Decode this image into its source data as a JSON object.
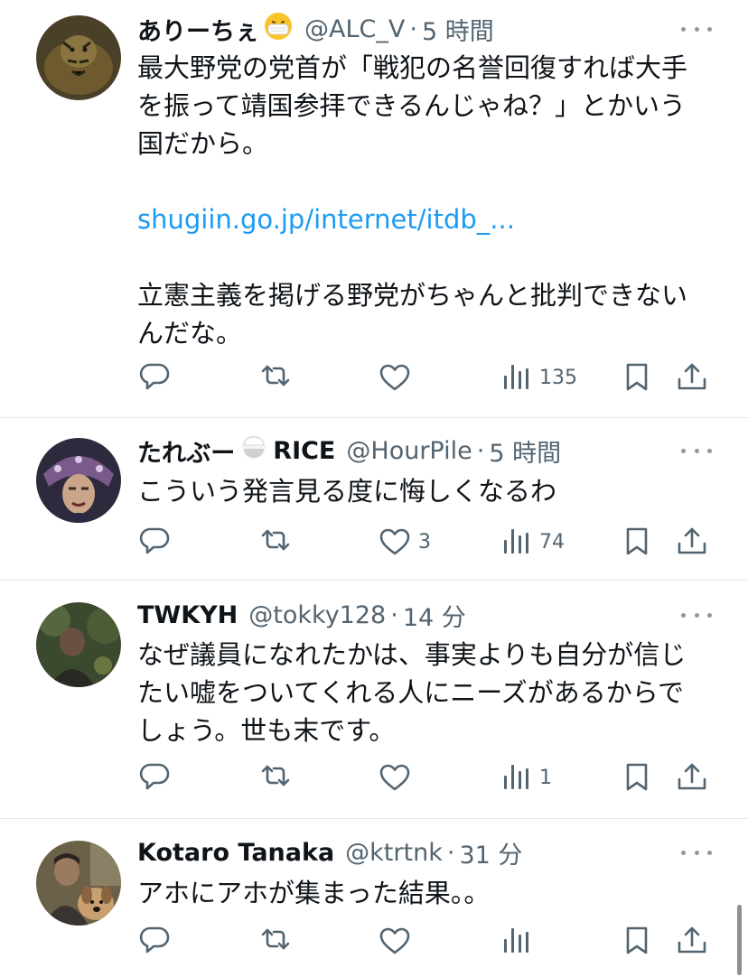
{
  "tweets": [
    {
      "name": "ありーちぇ",
      "emoji": "mask-face",
      "handle": "@ALC_V",
      "separator": "·",
      "time": "5 時間",
      "lines": [
        "最大野党の党首が「戦犯の名誉回復すれば大手",
        "を振って靖国参拝できるんじゃね？」とかいう",
        "国だから。"
      ],
      "link": "shugiin.go.jp/internet/itdb_...",
      "lines2": [
        "立憲主義を掲げる野党がちゃんと批判できない",
        "んだな。"
      ],
      "replies": "",
      "retweets": "",
      "likes": "",
      "views": "135"
    },
    {
      "name": "たれぶー",
      "emoji": "rice-bowl",
      "name_suffix": "RICE",
      "handle": "@HourPile",
      "separator": "·",
      "time": "5 時間",
      "lines": [
        "こういう発言見る度に悔しくなるわ"
      ],
      "replies": "",
      "retweets": "",
      "likes": "3",
      "views": "74"
    },
    {
      "name": "TWKYH",
      "handle": "@tokky128",
      "separator": "·",
      "time": "14 分",
      "lines": [
        "なぜ議員になれたかは、事実よりも自分が信じ",
        "たい嘘をついてくれる人にニーズがあるからで",
        "しょう。世も末です。"
      ],
      "replies": "",
      "retweets": "",
      "likes": "",
      "views": "1"
    },
    {
      "name": "Kotaro Tanaka",
      "handle": "@ktrtnk",
      "separator": "·",
      "time": "31 分",
      "lines": [
        "アホにアホが集まった結果。。"
      ],
      "replies": "",
      "retweets": "",
      "likes": "",
      "views": ""
    }
  ],
  "icons": {
    "reply": "reply-icon",
    "retweet": "retweet-icon",
    "like": "heart-icon",
    "views": "views-icon",
    "bookmark": "bookmark-icon",
    "share": "share-icon",
    "more": "more-icon"
  },
  "colors": {
    "text": "#0f1419",
    "secondary": "#536471",
    "link": "#1d9bf0",
    "divider": "#e6e9eb"
  }
}
